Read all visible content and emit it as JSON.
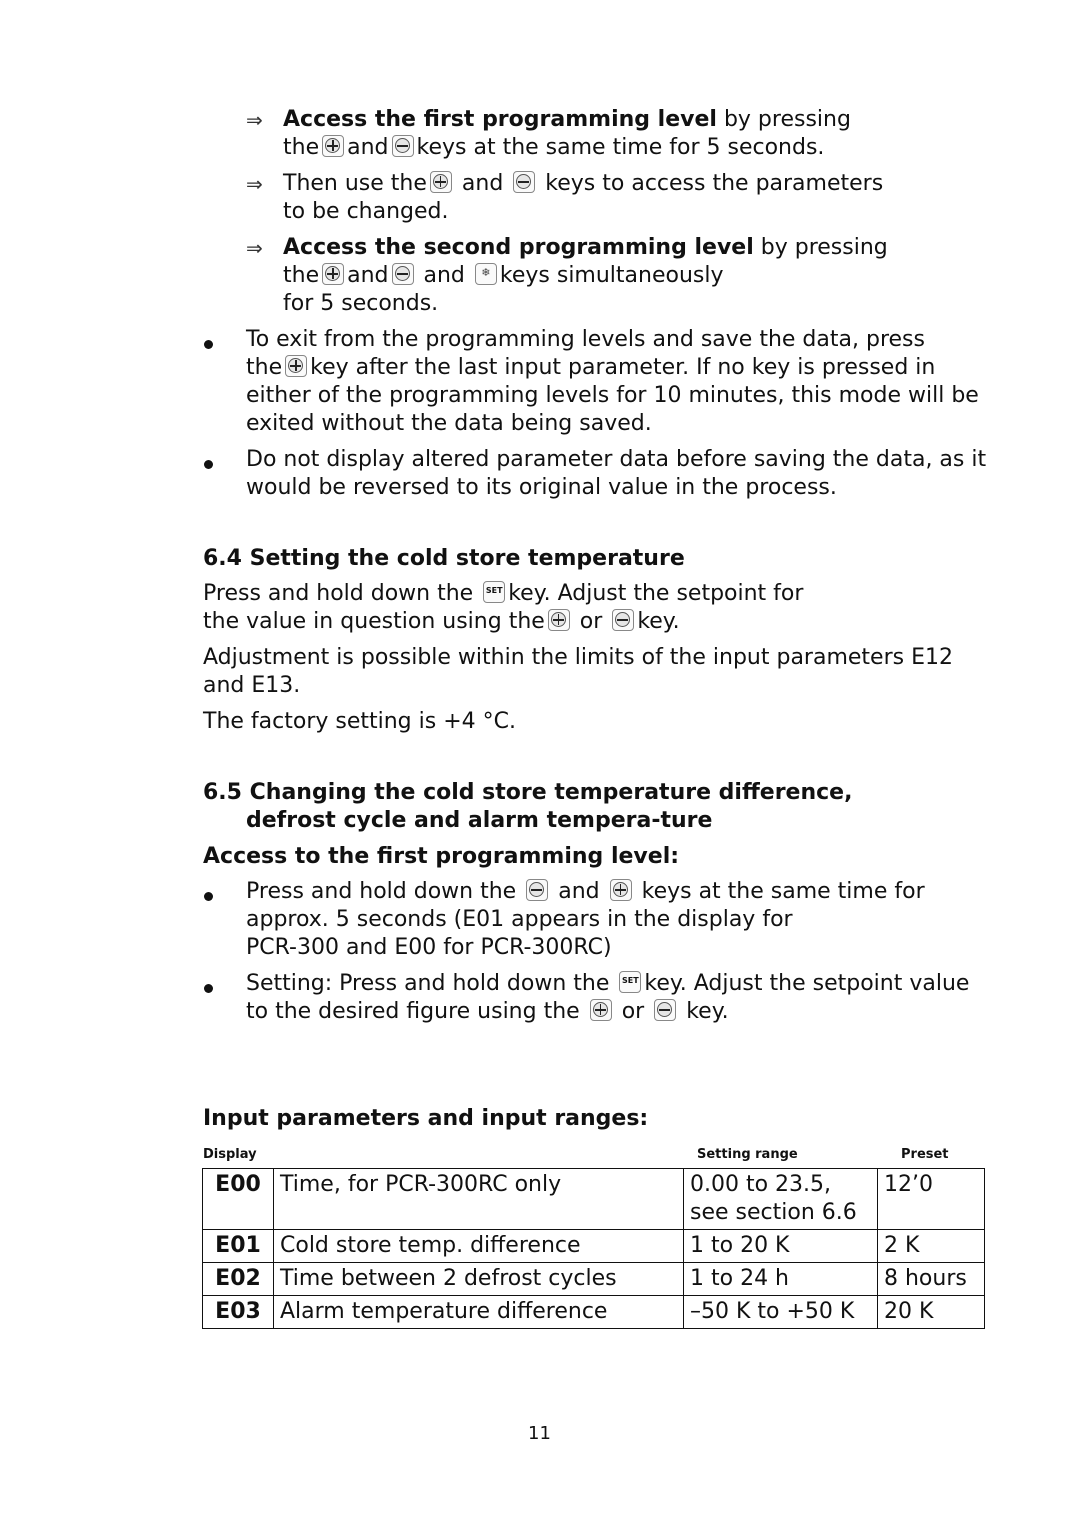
{
  "steps": [
    {
      "bold": "Access the first programming level",
      "text1": " by pressing",
      "l2a": "the",
      "l2b": "and",
      "l2c": "keys at the same time for 5 seconds."
    },
    {
      "text1a": "Then use the",
      "text1b": "and",
      "text1c": "keys to access the parameters",
      "l2": "to be changed."
    },
    {
      "bold": "Access the second programming level",
      "text1": " by pressing",
      "l2a": "the",
      "l2b": "and",
      "l2c": "and",
      "l2d": "keys simultaneously",
      "l3": "for 5 seconds."
    }
  ],
  "bullets1": [
    {
      "l1": "To exit from the programming levels and save the data, press",
      "l2a": "the",
      "l2b": "key after the last input parameter. If no key is pressed in",
      "l3": "either of the programming levels for 10 minutes, this mode will be",
      "l4": "exited without the data being saved."
    },
    {
      "l1": "Do not display altered parameter data before saving the data, as it",
      "l2": "would be reversed to its original value in the process."
    }
  ],
  "section64": {
    "title": "6.4 Setting the cold store temperature",
    "p1a": "Press and hold down the",
    "p1b": "key. Adjust the setpoint for",
    "p2a": "the value in question using the",
    "p2b": "or",
    "p2c": "key.",
    "p3": "Adjustment is possible within the limits of the input parameters E12",
    "p4": "and E13.",
    "p5": "The factory setting is +4 °C."
  },
  "section65": {
    "title1": "6.5 Changing the cold store temperature difference,",
    "title2": "defrost cycle and alarm tempera-ture",
    "sub": "Access to the first programming level:",
    "b1a": "Press and hold down the",
    "b1b": "and",
    "b1c": "keys at the same time for",
    "b1l2": "approx. 5 seconds (E01 appears in the display for",
    "b1l3": "PCR-300 and E00 for PCR-300RC)",
    "b2a": "Setting: Press and hold down the",
    "b2b": "key. Adjust the setpoint value",
    "b2l2a": "to the desired figure using the",
    "b2l2b": "or",
    "b2l2c": "key."
  },
  "params": {
    "title": "Input parameters and input ranges:",
    "headers": {
      "display": "Display",
      "range": "Setting range",
      "preset": "Preset"
    },
    "rows": [
      {
        "code": "E00",
        "desc": "Time, for PCR-300RC only",
        "range1": "0.00 to 23.5,",
        "range2": "see section 6.6",
        "preset": "12’0"
      },
      {
        "code": "E01",
        "desc": "Cold store temp. difference",
        "range1": "1 to 20 K",
        "range2": "",
        "preset": "2 K"
      },
      {
        "code": "E02",
        "desc": "Time between 2 defrost cycles",
        "range1": "1 to 24 h",
        "range2": "",
        "preset": "8 hours"
      },
      {
        "code": "E03",
        "desc": "Alarm temperature difference",
        "range1": "–50 K to +50 K",
        "range2": "",
        "preset": "20 K"
      }
    ]
  },
  "icons": {
    "arrow": "⅀",
    "set": "SET",
    "defrost": "❄"
  },
  "page_number": "11"
}
